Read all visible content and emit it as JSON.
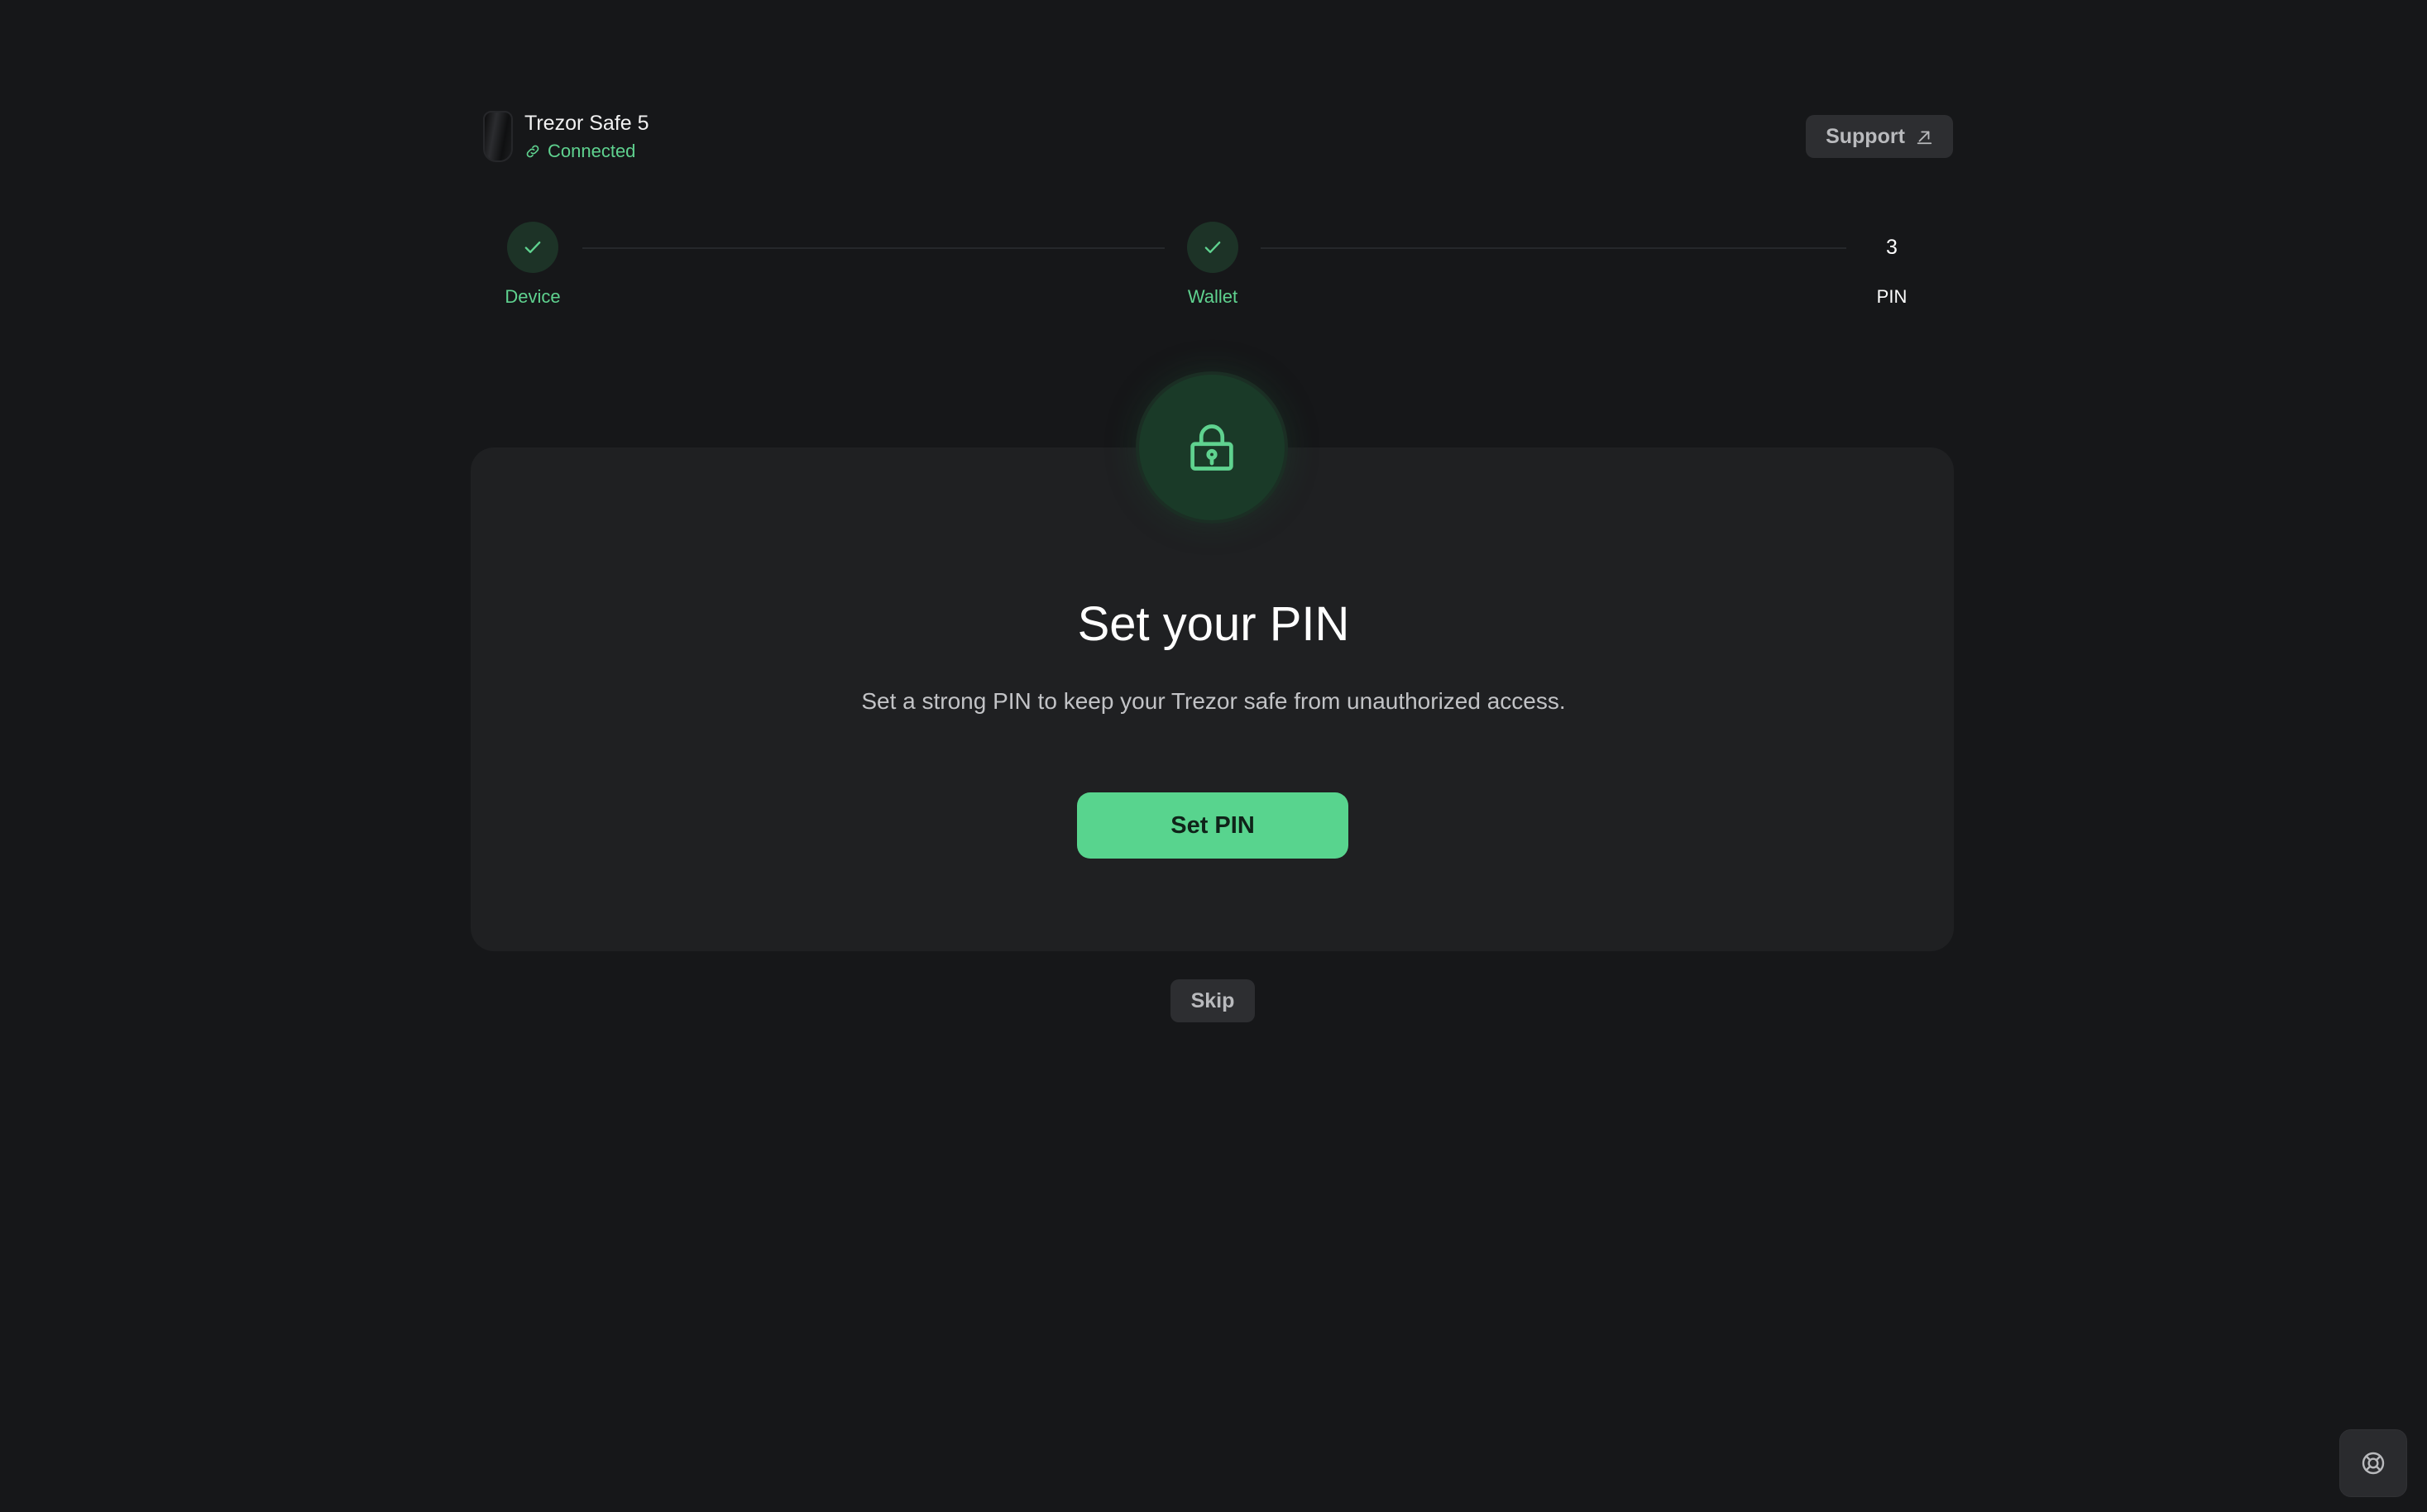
{
  "device": {
    "name": "Trezor Safe 5",
    "status": "Connected"
  },
  "header": {
    "support_label": "Support"
  },
  "stepper": {
    "steps": [
      {
        "label": "Device",
        "state": "done"
      },
      {
        "label": "Wallet",
        "state": "done"
      },
      {
        "label": "PIN",
        "state": "active",
        "number": "3"
      }
    ]
  },
  "card": {
    "title": "Set your PIN",
    "description": "Set a strong PIN to keep your Trezor safe from unauthorized access.",
    "primary_label": "Set PIN"
  },
  "skip_label": "Skip",
  "icons": {
    "status": "link-icon",
    "support": "external-link-icon",
    "step_done": "check-icon",
    "card": "lock-icon",
    "help": "lifebuoy-icon"
  },
  "colors": {
    "background": "#161719",
    "card": "#1f2022",
    "accent": "#58d48e",
    "accent_text": "#5fd28f",
    "step_circle": "#1d3327"
  }
}
